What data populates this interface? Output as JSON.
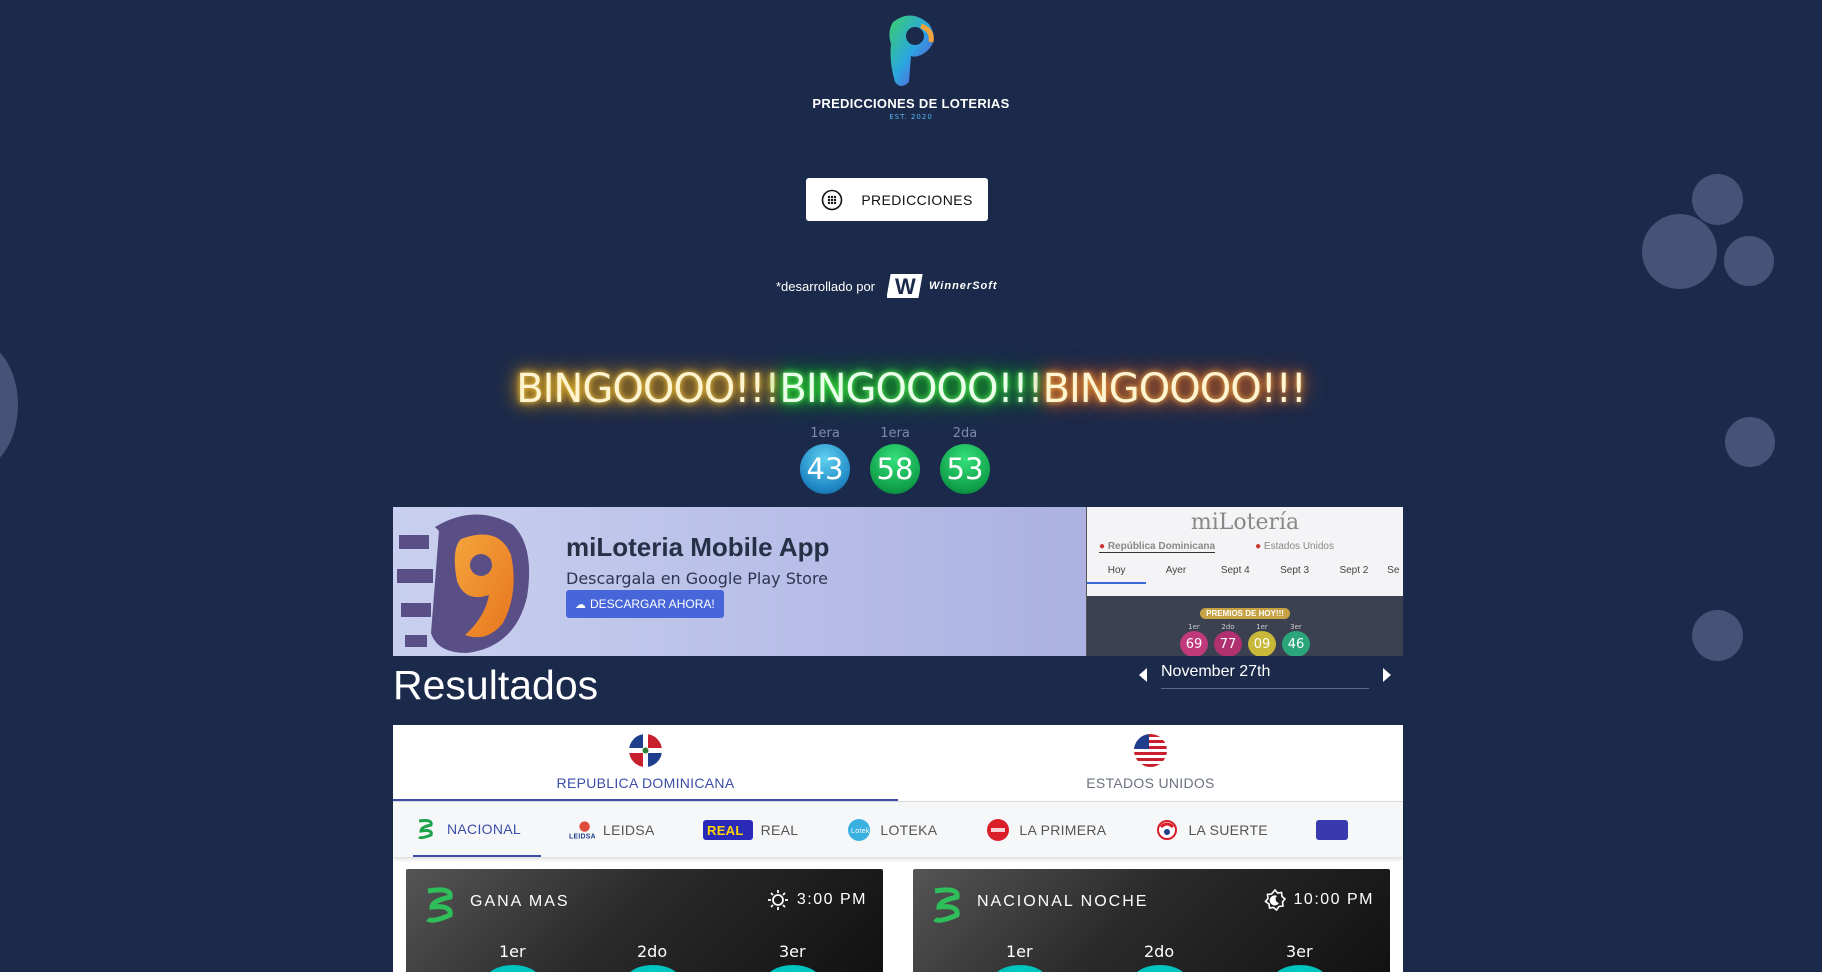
{
  "brand": {
    "title": "PREDICCIONES DE LOTERIAS",
    "est": "EST. 2020"
  },
  "nav": {
    "predictions_label": "PREDICCIONES"
  },
  "developer": {
    "prefix": "*desarrollado por",
    "company": "WinnerSoft"
  },
  "bingo": {
    "text1": "BINGOOOO!!!",
    "text2": "BINGOOOO!!!",
    "text3": "BINGOOOO!!!"
  },
  "winning_balls": [
    {
      "label": "1era",
      "number": "43",
      "color": "blue"
    },
    {
      "label": "1era",
      "number": "58",
      "color": "green"
    },
    {
      "label": "2da",
      "number": "53",
      "color": "green"
    }
  ],
  "app_banner": {
    "title": "miLoteria Mobile App",
    "subtitle": "Descargala en Google Play Store",
    "button": "DESCARGAR AHORA!",
    "preview": {
      "brand": "miLotería",
      "country_active": "República Dominicana",
      "country_other": "Estados Unidos",
      "days": [
        "Hoy",
        "Ayer",
        "Sept 4",
        "Sept 3",
        "Sept 2",
        "Se"
      ],
      "badge": "PREMIOS DE HOY!!!",
      "balls": [
        {
          "label": "1er",
          "number": "69",
          "color": "#c0397a"
        },
        {
          "label": "2do",
          "number": "77",
          "color": "#b03070"
        },
        {
          "label": "1er",
          "number": "09",
          "color": "#c8b83a"
        },
        {
          "label": "3er",
          "number": "46",
          "color": "#2aa67a"
        }
      ]
    }
  },
  "results": {
    "title": "Resultados",
    "date": "November 27th"
  },
  "country_tabs": [
    {
      "label": "REPUBLICA DOMINICANA",
      "active": true
    },
    {
      "label": "ESTADOS UNIDOS",
      "active": false
    }
  ],
  "lottery_tabs": [
    {
      "label": "NACIONAL",
      "icon": "nacional-icon",
      "active": true
    },
    {
      "label": "LEIDSA",
      "icon": "leidsa-icon",
      "active": false
    },
    {
      "label": "REAL",
      "icon": "loto-real-icon",
      "active": false
    },
    {
      "label": "LOTEKA",
      "icon": "loteka-icon",
      "active": false
    },
    {
      "label": "LA PRIMERA",
      "icon": "la-primera-icon",
      "active": false
    },
    {
      "label": "LA SUERTE",
      "icon": "la-suerte-icon",
      "active": false
    }
  ],
  "draws": [
    {
      "name": "GANA MAS",
      "time": "3:00 PM",
      "time_icon": "sun-icon",
      "positions": [
        "1er",
        "2do",
        "3er"
      ]
    },
    {
      "name": "NACIONAL NOCHE",
      "time": "10:00 PM",
      "time_icon": "moon-icon",
      "positions": [
        "1er",
        "2do",
        "3er"
      ]
    }
  ],
  "colors": {
    "background": "#1b2a4a",
    "accent": "#3b4ea8",
    "download_button": "#4766d9"
  }
}
